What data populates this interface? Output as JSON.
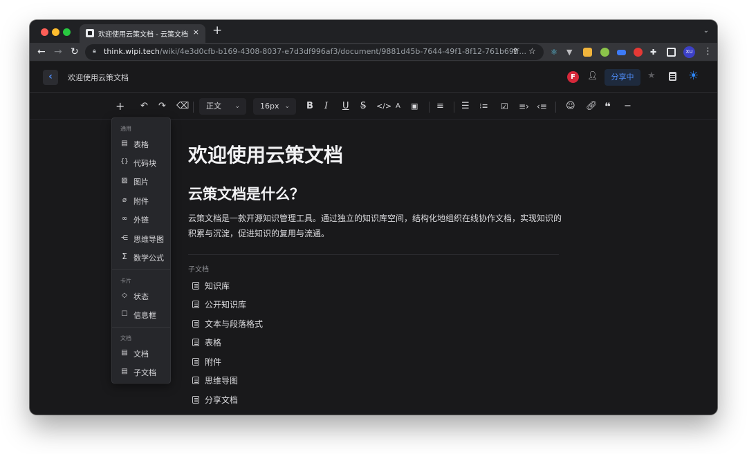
{
  "browser": {
    "tab_title": "欢迎使用云策文档 - 云策文档",
    "tab_close": "×",
    "new_tab": "+",
    "url_host": "think.wipi.tech",
    "url_path": "/wiki/4e3d0cfb-b169-4308-8037-e7d3df996af3/document/9881d45b-7644-49f1-8f12-761b69ff...",
    "profile_initials": "XU"
  },
  "header": {
    "back": "‹",
    "doc_title": "欢迎使用云策文档",
    "avatar_initial": "F",
    "share_label": "分享中"
  },
  "toolbar": {
    "paragraph_select": "正文",
    "font_size_select": "16px"
  },
  "insert_menu": {
    "groups": [
      {
        "label": "通用",
        "items": [
          {
            "label": "表格",
            "icon": "table-icon"
          },
          {
            "label": "代码块",
            "icon": "code-block-icon"
          },
          {
            "label": "图片",
            "icon": "image-icon"
          },
          {
            "label": "附件",
            "icon": "attachment-icon"
          },
          {
            "label": "外链",
            "icon": "link-icon"
          },
          {
            "label": "思维导图",
            "icon": "mindmap-icon"
          },
          {
            "label": "数学公式",
            "icon": "sigma-icon"
          }
        ]
      },
      {
        "label": "卡片",
        "items": [
          {
            "label": "状态",
            "icon": "tag-icon"
          },
          {
            "label": "信息框",
            "icon": "callout-icon"
          }
        ]
      },
      {
        "label": "文档",
        "items": [
          {
            "label": "文档",
            "icon": "document-icon"
          },
          {
            "label": "子文档",
            "icon": "child-document-icon"
          }
        ]
      }
    ]
  },
  "document": {
    "title": "欢迎使用云策文档",
    "heading": "云策文档是什么？",
    "paragraph": "云策文档是一款开源知识管理工具。通过独立的知识库空间，结构化地组织在线协作文档，实现知识的积累与沉淀，促进知识的复用与流通。",
    "subdocs_label": "子文档",
    "subdocs": [
      "知识库",
      "公开知识库",
      "文本与段落格式",
      "表格",
      "附件",
      "思维导图",
      "分享文档"
    ]
  }
}
